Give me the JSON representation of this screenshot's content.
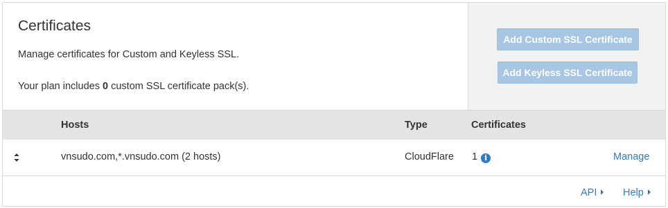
{
  "header": {
    "title": "Certificates",
    "description": "Manage certificates for Custom and Keyless SSL.",
    "plan_prefix": "Your plan includes ",
    "plan_count": "0",
    "plan_suffix": " custom SSL certificate pack(s)."
  },
  "actions": {
    "add_custom_label": "Add Custom SSL Certificate",
    "add_keyless_label": "Add Keyless SSL Certificate"
  },
  "table": {
    "columns": {
      "hosts": "Hosts",
      "type": "Type",
      "certificates": "Certificates"
    },
    "rows": [
      {
        "hosts": "vnsudo.com,*.vnsudo.com (2 hosts)",
        "type": "CloudFlare",
        "certificates": "1",
        "action": "Manage"
      }
    ]
  },
  "footer": {
    "api_label": "API",
    "help_label": "Help"
  },
  "icons": {
    "sort": "sort-icon",
    "info": "info-icon",
    "caret": "caret-right-icon"
  },
  "colors": {
    "button_bg": "#a6c6e4",
    "link": "#2f7bbf",
    "table_header_bg": "#e4e4e4",
    "side_panel_bg": "#f2f2f2"
  }
}
